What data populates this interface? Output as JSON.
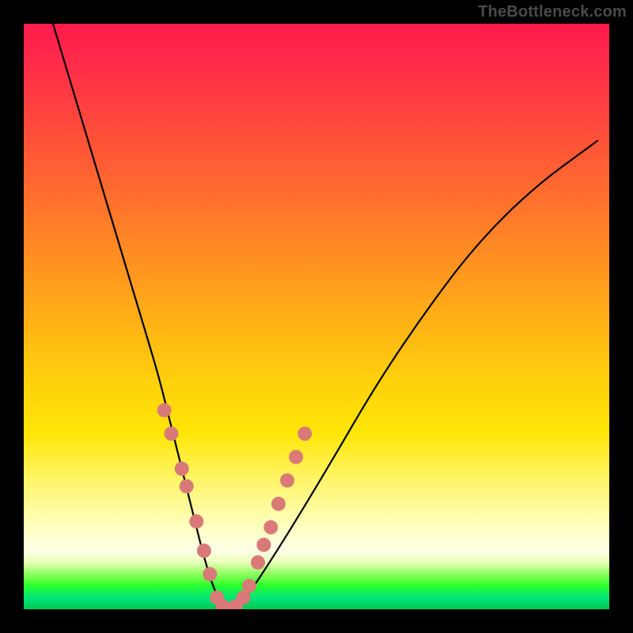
{
  "watermark": "TheBottleneck.com",
  "chart_data": {
    "type": "line",
    "title": "",
    "xlabel": "",
    "ylabel": "",
    "xlim": [
      0,
      100
    ],
    "ylim": [
      0,
      100
    ],
    "series": [
      {
        "name": "bottleneck-curve",
        "x": [
          5,
          8,
          11,
          14,
          17,
          20,
          23,
          25,
          27,
          29,
          31,
          33,
          35,
          38,
          42,
          47,
          53,
          60,
          68,
          77,
          87,
          98
        ],
        "y": [
          100,
          90,
          80,
          70,
          60,
          50,
          40,
          32,
          24,
          16,
          8,
          2,
          0,
          2,
          8,
          16,
          26,
          38,
          50,
          62,
          72,
          80
        ]
      }
    ],
    "highlighted_points": {
      "name": "marker-dots",
      "color": "#d97a78",
      "x": [
        24,
        25.2,
        27,
        27.8,
        29.5,
        30.8,
        31.8,
        33,
        34,
        35,
        36.2,
        37.5,
        38.5,
        40,
        41,
        42.2,
        43.5,
        45,
        46.5,
        48
      ],
      "y": [
        34,
        30,
        24,
        21,
        15,
        10,
        6,
        2,
        0.5,
        0,
        0.5,
        2,
        4,
        8,
        11,
        14,
        18,
        22,
        26,
        30
      ]
    },
    "background_gradient": {
      "orientation": "vertical",
      "stops": [
        {
          "pos": 0.0,
          "color": "#ff1a4d"
        },
        {
          "pos": 0.5,
          "color": "#ffb514"
        },
        {
          "pos": 0.8,
          "color": "#fff56a"
        },
        {
          "pos": 0.95,
          "color": "#2aff2a"
        },
        {
          "pos": 1.0,
          "color": "#00c853"
        }
      ]
    }
  }
}
